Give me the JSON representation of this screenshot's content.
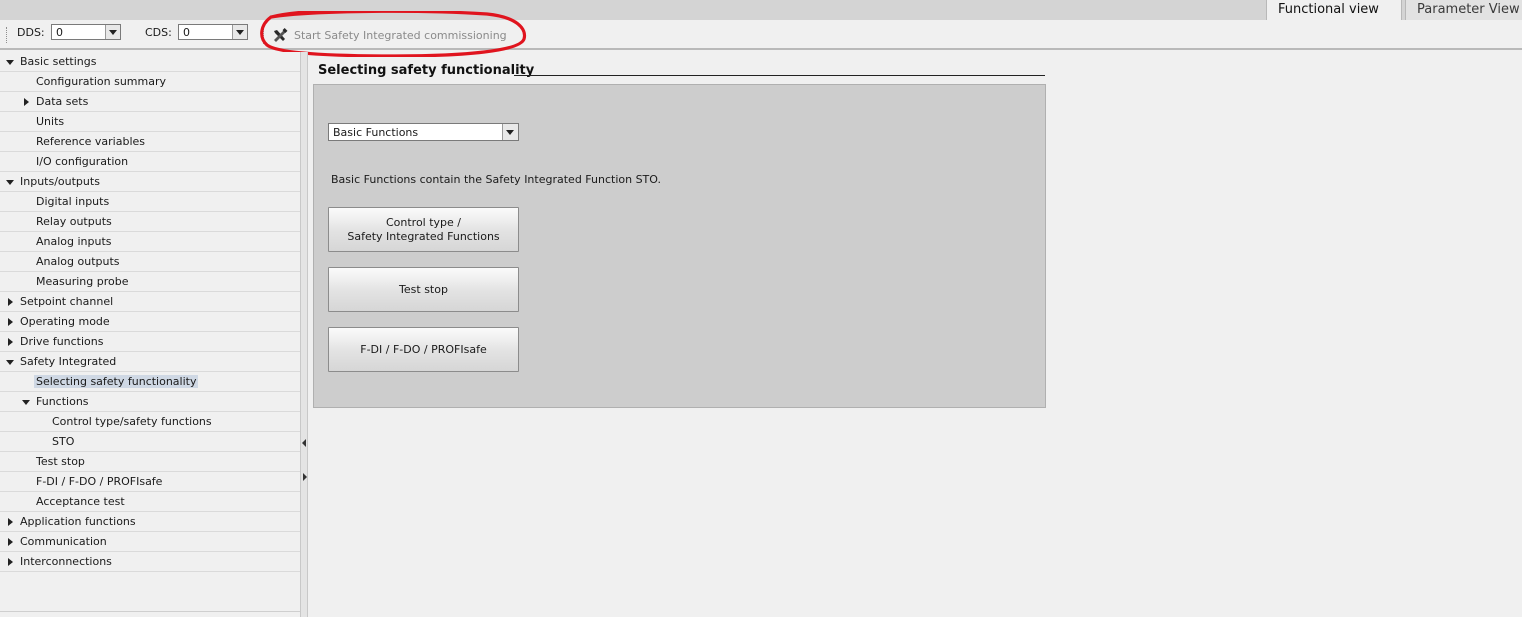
{
  "tabs": {
    "functional_view": "Functional view",
    "parameter_view": "Parameter View"
  },
  "toolbar": {
    "dds_label": "DDS:",
    "dds_value": "0",
    "cds_label": "CDS:",
    "cds_value": "0",
    "start_commissioning": "Start Safety Integrated commissioning",
    "annotation_color": "#e0141e"
  },
  "tree": {
    "items": [
      {
        "label": "Basic settings",
        "level": 0,
        "state": "expanded"
      },
      {
        "label": "Configuration summary",
        "level": 1,
        "state": "leaf"
      },
      {
        "label": "Data sets",
        "level": 1,
        "state": "collapsed"
      },
      {
        "label": "Units",
        "level": 1,
        "state": "leaf"
      },
      {
        "label": "Reference variables",
        "level": 1,
        "state": "leaf"
      },
      {
        "label": "I/O configuration",
        "level": 1,
        "state": "leaf"
      },
      {
        "label": "Inputs/outputs",
        "level": 0,
        "state": "expanded"
      },
      {
        "label": "Digital inputs",
        "level": 1,
        "state": "leaf"
      },
      {
        "label": "Relay outputs",
        "level": 1,
        "state": "leaf"
      },
      {
        "label": "Analog inputs",
        "level": 1,
        "state": "leaf"
      },
      {
        "label": "Analog outputs",
        "level": 1,
        "state": "leaf"
      },
      {
        "label": "Measuring probe",
        "level": 1,
        "state": "leaf"
      },
      {
        "label": "Setpoint channel",
        "level": 0,
        "state": "collapsed"
      },
      {
        "label": "Operating mode",
        "level": 0,
        "state": "collapsed"
      },
      {
        "label": "Drive functions",
        "level": 0,
        "state": "collapsed"
      },
      {
        "label": "Safety Integrated",
        "level": 0,
        "state": "expanded"
      },
      {
        "label": "Selecting safety functionality",
        "level": 1,
        "state": "leaf",
        "selected": true
      },
      {
        "label": "Functions",
        "level": 1,
        "state": "expanded"
      },
      {
        "label": "Control type/safety functions",
        "level": 2,
        "state": "leaf"
      },
      {
        "label": "STO",
        "level": 2,
        "state": "leaf"
      },
      {
        "label": "Test stop",
        "level": 1,
        "state": "leaf"
      },
      {
        "label": "F-DI / F-DO / PROFIsafe",
        "level": 1,
        "state": "leaf"
      },
      {
        "label": "Acceptance test",
        "level": 1,
        "state": "leaf"
      },
      {
        "label": "Application functions",
        "level": 0,
        "state": "collapsed"
      },
      {
        "label": "Communication",
        "level": 0,
        "state": "collapsed"
      },
      {
        "label": "Interconnections",
        "level": 0,
        "state": "collapsed"
      }
    ]
  },
  "main": {
    "section_title": "Selecting safety functionality",
    "function_select": "Basic Functions",
    "description": "Basic Functions contain the Safety Integrated Function STO.",
    "buttons": [
      "Control type /\nSafety Integrated Functions",
      "Test stop",
      "F-DI / F-DO / PROFIsafe"
    ]
  }
}
